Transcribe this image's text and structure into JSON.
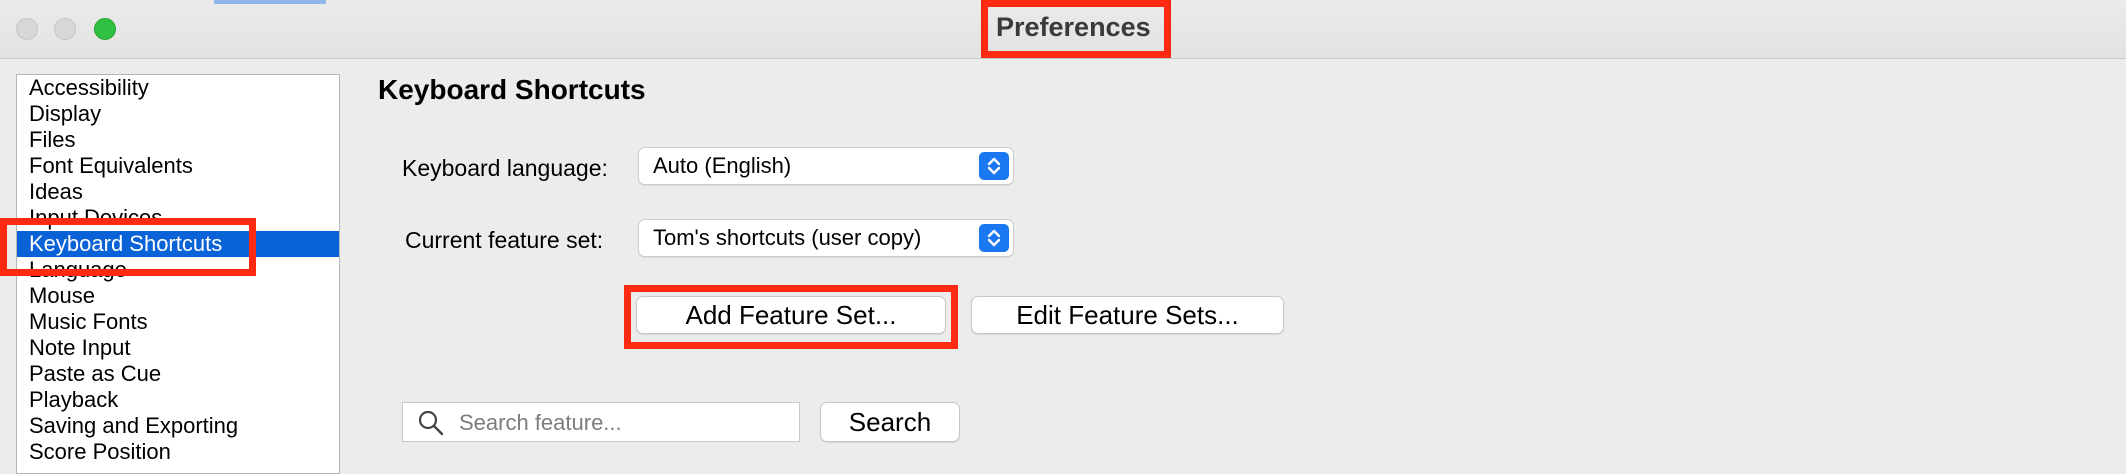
{
  "window": {
    "title": "Preferences"
  },
  "sidebar": {
    "items": [
      {
        "label": "Accessibility",
        "selected": false
      },
      {
        "label": "Display",
        "selected": false
      },
      {
        "label": "Files",
        "selected": false
      },
      {
        "label": "Font Equivalents",
        "selected": false
      },
      {
        "label": "Ideas",
        "selected": false
      },
      {
        "label": "Input Devices",
        "selected": false
      },
      {
        "label": "Keyboard Shortcuts",
        "selected": true
      },
      {
        "label": "Language",
        "selected": false
      },
      {
        "label": "Mouse",
        "selected": false
      },
      {
        "label": "Music Fonts",
        "selected": false
      },
      {
        "label": "Note Input",
        "selected": false
      },
      {
        "label": "Paste as Cue",
        "selected": false
      },
      {
        "label": "Playback",
        "selected": false
      },
      {
        "label": "Saving and Exporting",
        "selected": false
      },
      {
        "label": "Score Position",
        "selected": false
      }
    ]
  },
  "main": {
    "title": "Keyboard Shortcuts",
    "keyboard_language": {
      "label": "Keyboard language:",
      "value": "Auto (English)"
    },
    "feature_set": {
      "label": "Current feature set:",
      "value": "Tom's shortcuts (user copy)"
    },
    "add_button": "Add Feature Set...",
    "edit_button": "Edit Feature Sets...",
    "search": {
      "placeholder": "Search feature...",
      "value": "",
      "button": "Search"
    }
  },
  "colors": {
    "selection": "#0962d6",
    "highlight": "#ff2a12",
    "close": "#2fc041"
  }
}
